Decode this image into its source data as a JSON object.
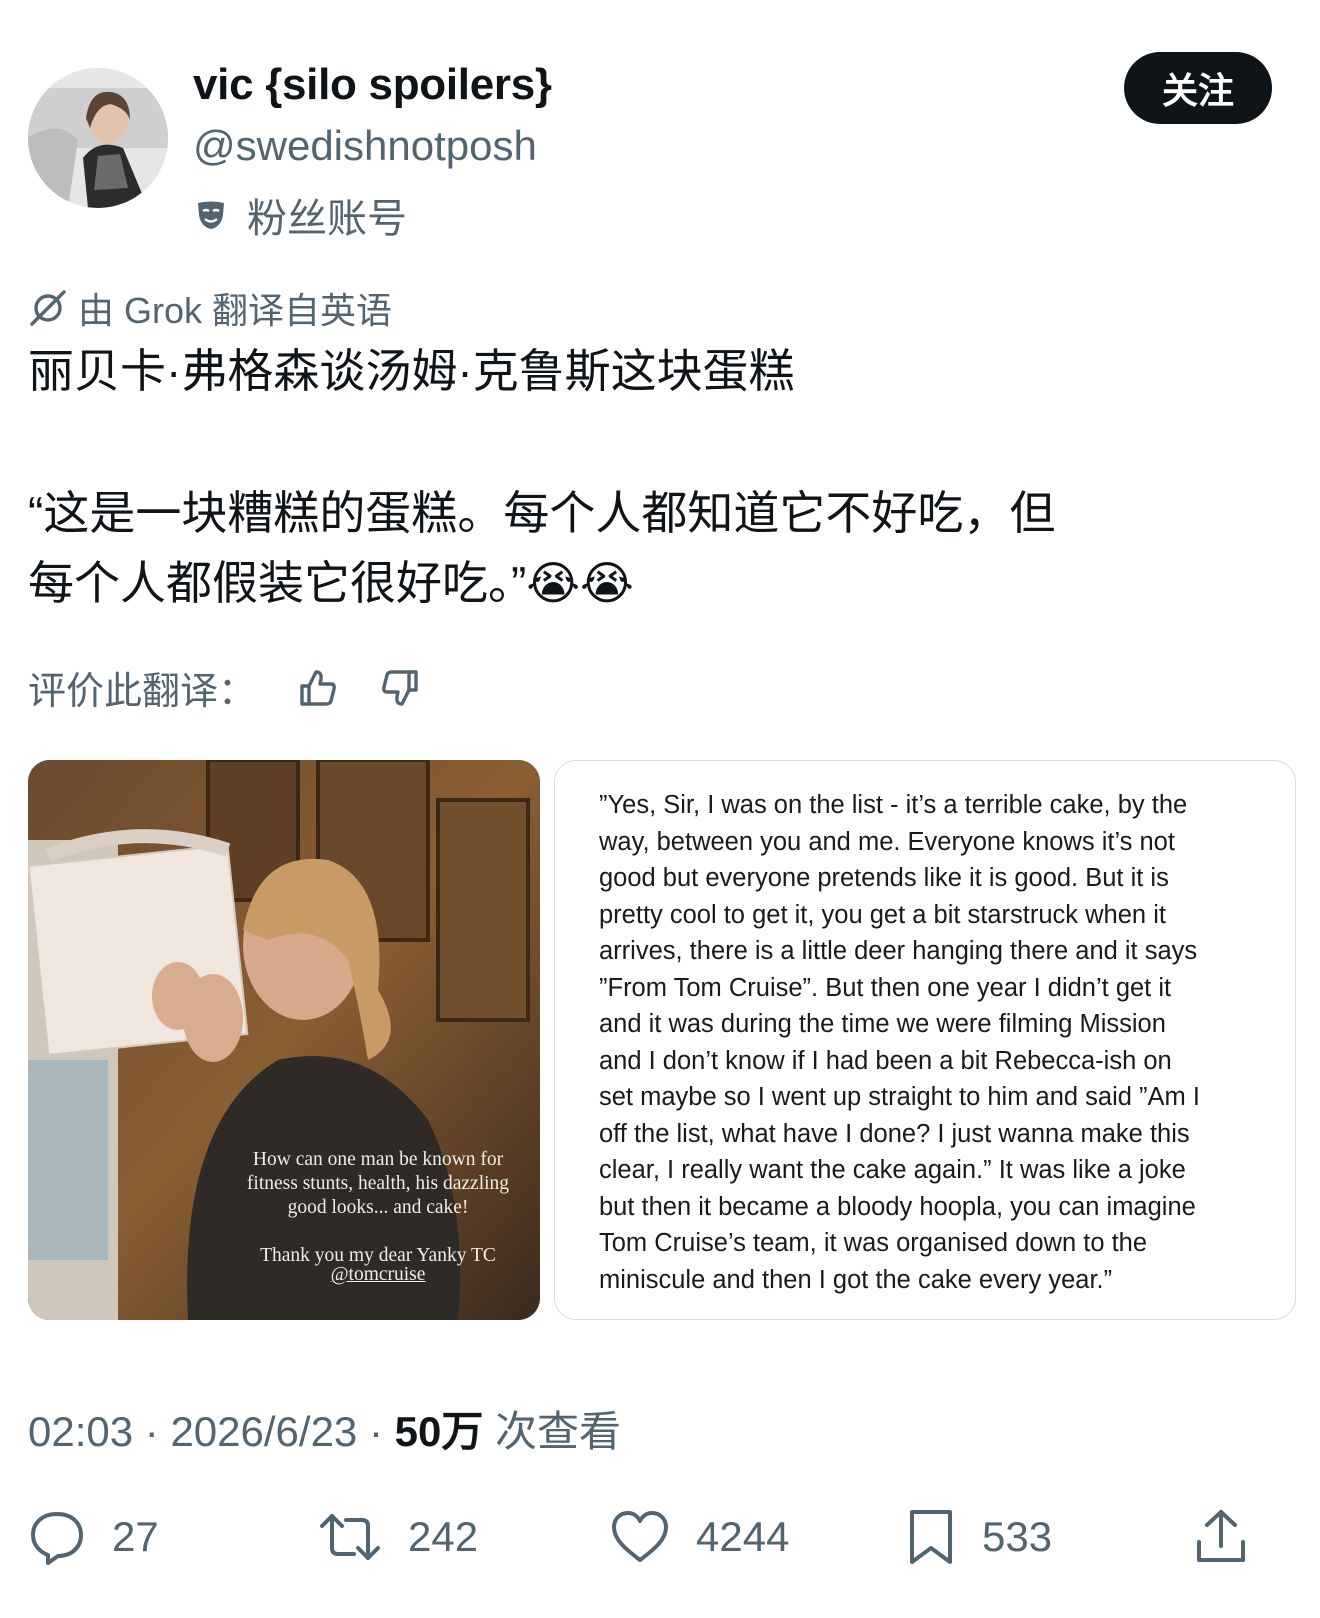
{
  "author": {
    "display_name": "vic {silo spoilers}",
    "handle": "@swedishnotposh",
    "badge_label": "粉丝账号",
    "badge_icon": "mask-icon"
  },
  "follow_button": {
    "label": "关注"
  },
  "translation": {
    "notice": "由 Grok 翻译自英语",
    "rate_label": "评价此翻译："
  },
  "tweet": {
    "line1": "丽贝卡·弗格森谈汤姆·克鲁斯这块蛋糕",
    "line2": "“这是一块糟糕的蛋糕。每个人都知道它不好吃，但",
    "line3": "每个人都假装它很好吃。”😭😭"
  },
  "media": {
    "photo_caption": "How can one man be known for\nfitness stunts, health, his dazzling\ngood looks... and cake!\n\nThank you my dear Yanky TC",
    "photo_handle": "@tomcruise",
    "quote_text": "”Yes, Sir, I was on the list - it’s a terrible cake, by the\nway, between you and me. Everyone knows it’s not\ngood but everyone pretends like it is good. But it is\npretty cool to get it, you get a bit starstruck when it\narrives, there is a little deer hanging there and it says\n”From Tom Cruise”. But then one year I didn’t get it\nand it was during the time we were filming Mission\nand I don’t know if I had been a bit Rebecca-ish on\nset maybe so I went up straight to him and said ”Am I\noff the list, what have I done? I just wanna make this\nclear, I really want the cake again.” It was like a joke\nbut then it became a bloody hoopla, you can imagine\nTom Cruise’s team, it was organised down to the\nminiscule and then I got the cake every year.”"
  },
  "meta": {
    "time": "02:03",
    "date": "2026/6/23",
    "views_count": "50万",
    "views_label": "次查看"
  },
  "actions": {
    "replies": "27",
    "retweets": "242",
    "likes": "4244",
    "bookmarks": "533"
  },
  "colors": {
    "text_primary": "#0f1419",
    "text_secondary": "#536471",
    "button_bg": "#0f1419"
  }
}
